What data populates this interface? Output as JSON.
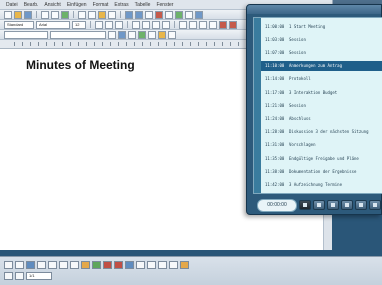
{
  "document": {
    "title": "Minutes of Meeting"
  },
  "menubar": {
    "items": [
      "Datei",
      "Bearb.",
      "Ansicht",
      "Einfügen",
      "Format",
      "Extras",
      "Tabelle",
      "Fenster"
    ]
  },
  "toolbar": {
    "style_value": "Standard",
    "font_value": "Arial",
    "size_value": "12"
  },
  "agenda_panel": {
    "header": "",
    "items": [
      {
        "time": "11:00:00",
        "title": "1 Start Meeting"
      },
      {
        "time": "11:03:00",
        "title": "Session"
      },
      {
        "time": "11:07:00",
        "title": "Session"
      },
      {
        "time": "11:10:00",
        "title": "Anmerkungen zum Antrag"
      },
      {
        "time": "11:14:00",
        "title": "Protokoll"
      },
      {
        "time": "11:17:00",
        "title": "3 Interaktion Budget"
      },
      {
        "time": "11:21:00",
        "title": "Session"
      },
      {
        "time": "11:24:00",
        "title": "Abschluss"
      },
      {
        "time": "11:28:00",
        "title": "Diskussion 3 der nächsten Sitzung"
      },
      {
        "time": "11:31:00",
        "title": "Vorschlagen"
      },
      {
        "time": "11:35:00",
        "title": "Endgültige Freigabe und Pläne"
      },
      {
        "time": "11:38:00",
        "title": "Dokumentation der Ergebnisse"
      },
      {
        "time": "11:42:00",
        "title": "3 Aufzeichnung Termine"
      }
    ],
    "selected_index": 3,
    "time_display": "00:00:00"
  },
  "status_bar": {
    "page_field": "1/1"
  },
  "colors": {
    "panel_bg": "#2d5a7b",
    "list_bg": "#dff4f7",
    "selected_row": "#1f5f8a",
    "page_bg": "#ffffff"
  }
}
